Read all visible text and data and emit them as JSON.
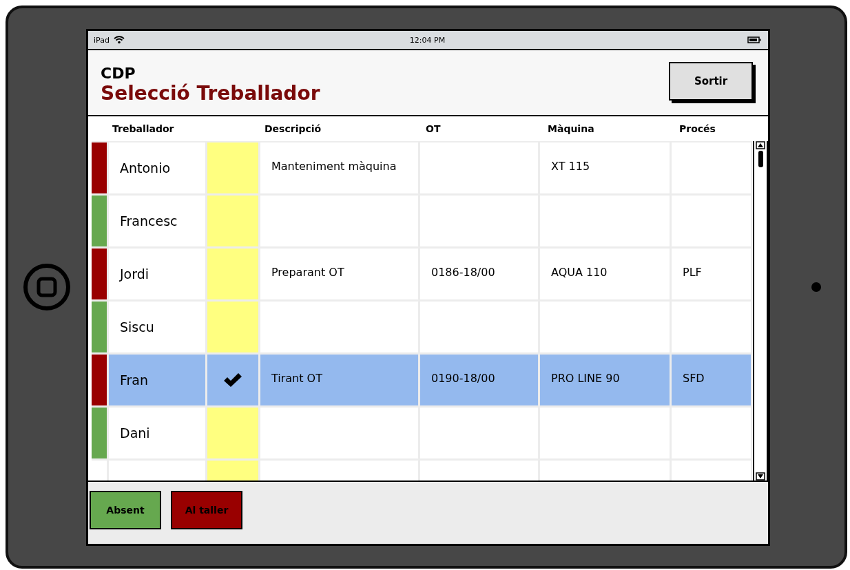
{
  "status_bar": {
    "device": "iPad",
    "time": "12:04 PM"
  },
  "header": {
    "app": "CDP",
    "title": "Selecció Treballador",
    "exit_button": "Sortir"
  },
  "table": {
    "columns": [
      "Treballador",
      "Descripció",
      "OT",
      "Màquina",
      "Procés"
    ],
    "rows": [
      {
        "name": "Antonio",
        "color": "#990000",
        "selected": false,
        "description": "Manteniment màquina",
        "machine": "XT 115"
      },
      {
        "name": "Francesc",
        "color": "#66a84f",
        "selected": false
      },
      {
        "name": "Jordi",
        "color": "#990000",
        "selected": false,
        "description": "Preparant OT",
        "ot": "0186-18/00",
        "machine": "AQUA 110",
        "process": "PLF"
      },
      {
        "name": "Siscu",
        "color": "#66a84f",
        "selected": false
      },
      {
        "name": "Fran",
        "color": "#990000",
        "selected": true,
        "description": "Tirant OT",
        "ot": "0190-18/00",
        "machine": "PRO LINE 90",
        "process": "SFD"
      },
      {
        "name": "Dani",
        "color": "#66a84f",
        "selected": false
      }
    ]
  },
  "buttons": [
    {
      "label": "Absent",
      "color": "#66a84f"
    },
    {
      "label": "Al taller",
      "color": "#990000"
    }
  ]
}
